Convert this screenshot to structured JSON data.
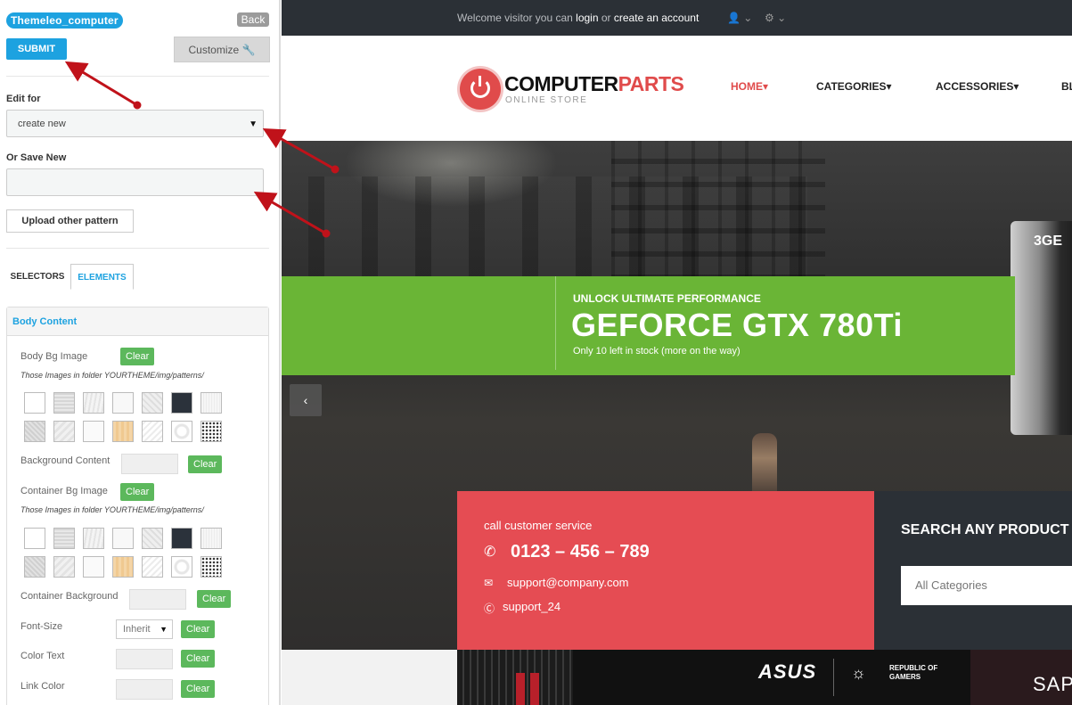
{
  "panel": {
    "theme_name": "Themeleo_computer",
    "back_label": "Back",
    "submit_label": "SUBMIT",
    "customize_label": "Customize",
    "edit_for_label": "Edit for",
    "edit_for_value": "create new",
    "or_save_new_label": "Or Save New",
    "save_new_value": "",
    "upload_label": "Upload other pattern",
    "tabs": {
      "selectors": "SELECTORS",
      "elements": "ELEMENTS"
    },
    "section_title": "Body Content",
    "rows": {
      "body_bg_image": "Body Bg Image",
      "note1": "Those Images in folder YOURTHEME/img/patterns/",
      "background_content": "Background Content",
      "container_bg_image": "Container Bg Image",
      "note2": "Those Images in folder YOURTHEME/img/patterns/",
      "container_background": "Container Background",
      "font_size": "Font-Size",
      "font_size_value": "Inherit",
      "color_text": "Color Text",
      "link_color": "Link Color"
    },
    "clear_label": "Clear"
  },
  "site": {
    "topbar": {
      "welcome_prefix": "Welcome visitor you can",
      "login": "login",
      "or": "or",
      "create_account": "create an account"
    },
    "logo": {
      "part1": "COMPUTER",
      "part2": "PARTS",
      "sub": "ONLINE STORE"
    },
    "nav": {
      "home": "HOME",
      "categories": "CATEGORIES",
      "accessories": "ACCESSORIES",
      "partial": "BL"
    },
    "banner": {
      "kicker": "UNLOCK ULTIMATE PERFORMANCE",
      "title": "GEFORCE GTX 780Ti",
      "subtitle": "Only 10 left in stock (more on the way)"
    },
    "card_label": "3GE",
    "support": {
      "call": "call customer service",
      "phone": "0123 – 456 – 789",
      "email": "support@company.com",
      "skype": "support_24"
    },
    "search": {
      "title": "SEARCH ANY PRODUCT",
      "category": "All Categories"
    },
    "promo": {
      "asus": "ASUS",
      "rog": "REPUBLIC OF GAMERS",
      "sapp": "SAPP"
    }
  },
  "colors": {
    "accent": "#1da2e0",
    "green": "#6ab536",
    "red": "#e54c53",
    "dark": "#2b3036",
    "clear_green": "#5cb85c"
  }
}
